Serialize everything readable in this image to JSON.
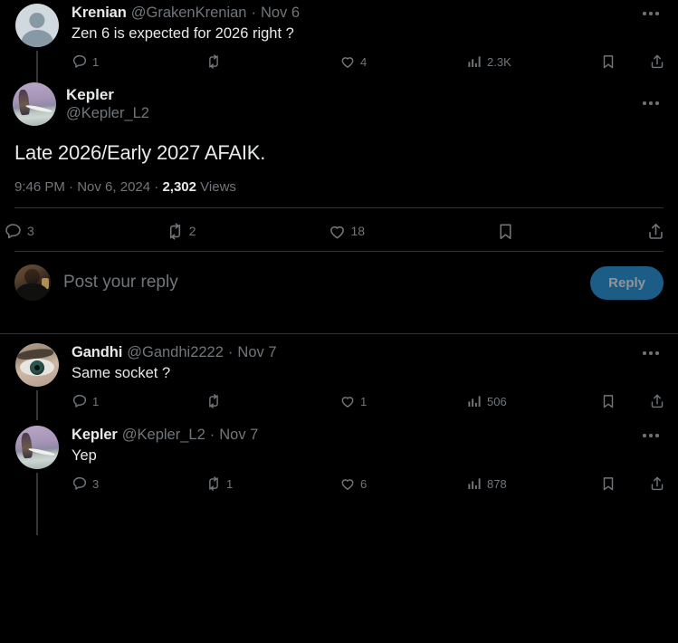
{
  "theme": {
    "background": "#000000",
    "text_primary": "#e7e9ea",
    "text_secondary": "#71767b",
    "divider": "#2f3336",
    "thread_line": "#333639",
    "reply_button_bg": "#1c5d88",
    "reply_button_text": "#8d9599"
  },
  "parent_post": {
    "display_name": "Krenian",
    "handle": "@GrakenKrenian",
    "separator": "·",
    "date": "Nov 6",
    "text": "Zen 6 is expected for 2026 right ?",
    "avatar": "default-person-avatar",
    "more_label": "More",
    "actions": {
      "reply_count": "1",
      "repost_count": "",
      "like_count": "4",
      "views_count": "2.3K",
      "bookmark_label": "Bookmark",
      "share_label": "Share"
    }
  },
  "focus_post": {
    "display_name": "Kepler",
    "handle": "@Kepler_L2",
    "text": "Late 2026/Early 2027 AFAIK.",
    "avatar": "kepler-artwork-avatar",
    "more_label": "More",
    "meta": {
      "time": "9:46 PM",
      "sep1": "·",
      "date": "Nov 6, 2024",
      "sep2": "·",
      "views_number": "2,302",
      "views_label": "Views"
    },
    "actions": {
      "reply_count": "3",
      "repost_count": "2",
      "like_count": "18",
      "bookmark_label": "Bookmark",
      "share_label": "Share"
    }
  },
  "composer": {
    "placeholder": "Post your reply",
    "button_label": "Reply",
    "avatar": "user-portrait-avatar"
  },
  "replies": [
    {
      "display_name": "Gandhi",
      "handle": "@Gandhi2222",
      "separator": "·",
      "date": "Nov 7",
      "text": "Same socket ?",
      "avatar": "eye-photo-avatar",
      "more_label": "More",
      "actions": {
        "reply_count": "1",
        "repost_count": "",
        "like_count": "1",
        "views_count": "506",
        "bookmark_label": "Bookmark",
        "share_label": "Share"
      }
    },
    {
      "display_name": "Kepler",
      "handle": "@Kepler_L2",
      "separator": "·",
      "date": "Nov 7",
      "text": "Yep",
      "avatar": "kepler-artwork-avatar",
      "more_label": "More",
      "actions": {
        "reply_count": "3",
        "repost_count": "1",
        "like_count": "6",
        "views_count": "878",
        "bookmark_label": "Bookmark",
        "share_label": "Share"
      }
    }
  ]
}
